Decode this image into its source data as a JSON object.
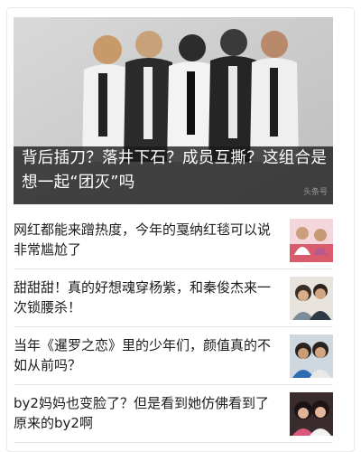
{
  "featured": {
    "title": "背后插刀？落井下石？成员互撕？这组合是想一起“团灭”吗",
    "image_icon": "group-photo",
    "watermark": "头条号"
  },
  "articles": [
    {
      "title": "网红都能来蹭热度，今年的戛纳红毯可以说非常尴尬了",
      "thumb_icon": "photo-thumbnail"
    },
    {
      "title": "甜甜甜！真的好想魂穿杨紫，和秦俊杰来一次锁腰杀！",
      "thumb_icon": "photo-thumbnail"
    },
    {
      "title": "当年《暹罗之恋》里的少年们，颜值真的不如从前吗？",
      "thumb_icon": "photo-thumbnail"
    },
    {
      "title": "by2妈妈也变脸了？但是看到她仿佛看到了原来的by2啊",
      "thumb_icon": "photo-thumbnail"
    }
  ]
}
